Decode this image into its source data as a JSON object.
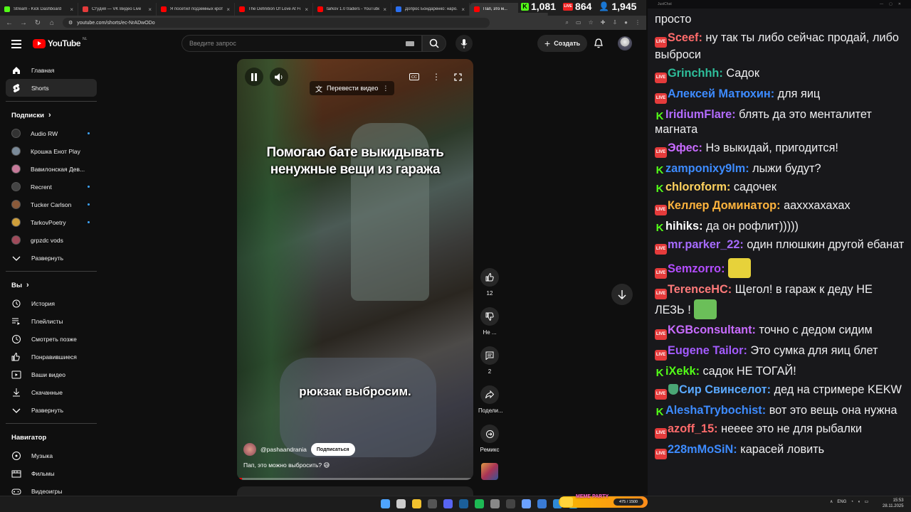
{
  "browser": {
    "tabs": [
      {
        "title": "Stream - Kick Dashboard",
        "color": "#53fc18"
      },
      {
        "title": "Студия — VK Видео Live",
        "color": "#e53b3b"
      },
      {
        "title": "Я посетил подземных крот...",
        "color": "#ff0000"
      },
      {
        "title": "The Definition Of Love At Fi...",
        "color": "#ff0000"
      },
      {
        "title": "tarkov 1.0 traders - YouTube",
        "color": "#ff0000"
      },
      {
        "title": "Допрос Бондаренко: наро...",
        "color": "#2a6ff0"
      },
      {
        "title": "Пап, это м...",
        "color": "#ff0000"
      }
    ],
    "url": "youtube.com/shorts/ec-NrADwODo"
  },
  "counters": {
    "kick": "1,081",
    "live": "864",
    "viewers": "1,945"
  },
  "youtube": {
    "logo": "YouTube",
    "region": "NL",
    "search_placeholder": "Введите запрос",
    "create_label": "Создать"
  },
  "sidebar": {
    "main": [
      {
        "label": "Главная",
        "icon": "home-icon"
      },
      {
        "label": "Shorts",
        "icon": "shorts-icon"
      }
    ],
    "subs_heading": "Подписки",
    "subscriptions": [
      {
        "label": "Audio RW",
        "dot": true,
        "color": "#333333"
      },
      {
        "label": "Крошка Енот Play",
        "dot": false,
        "color": "#7a8a99"
      },
      {
        "label": "Вавилонская Дев...",
        "dot": false,
        "color": "#c77a9a"
      },
      {
        "label": "Recrent",
        "dot": true,
        "color": "#444444"
      },
      {
        "label": "Tucker Carlson",
        "dot": true,
        "color": "#8a5a3a"
      },
      {
        "label": "TarkovPoetry",
        "dot": true,
        "color": "#cf9f3a"
      },
      {
        "label": "grpzdc vods",
        "dot": false,
        "color": "#a04a5a"
      },
      {
        "label": "Развернуть",
        "dot": false,
        "color": ""
      }
    ],
    "you_heading": "Вы",
    "you": [
      {
        "label": "История",
        "icon": "history-icon"
      },
      {
        "label": "Плейлисты",
        "icon": "playlists-icon"
      },
      {
        "label": "Смотреть позже",
        "icon": "watch-later-icon"
      },
      {
        "label": "Понравившиеся",
        "icon": "liked-icon"
      },
      {
        "label": "Ваши видео",
        "icon": "your-videos-icon"
      },
      {
        "label": "Скачанные",
        "icon": "downloads-icon"
      },
      {
        "label": "Развернуть",
        "icon": "chevron-down-icon"
      }
    ],
    "nav_heading": "Навигатор",
    "navigator": [
      {
        "label": "Музыка",
        "icon": "music-icon"
      },
      {
        "label": "Фильмы",
        "icon": "movies-icon"
      },
      {
        "label": "Видеоигры",
        "icon": "gaming-icon"
      }
    ]
  },
  "short": {
    "translate_label": "Перевести видео",
    "overlay_text": "Помогаю бате выкидывать ненужные вещи из гаража",
    "subtitle_text": "рюкзак выбросим.",
    "channel": "@pashaandrania",
    "subscribe_label": "Подписаться",
    "caption": "Пап, это можно выбросить? 😅",
    "progress": 0.02,
    "likes": "12",
    "dislike_label": "Не ...",
    "comments": "2",
    "share_label": "Подели...",
    "remix_label": "Ремикс"
  },
  "chat": {
    "app": "JustChat",
    "messages": [
      {
        "platform": "",
        "user": "",
        "color": "",
        "text": "просто"
      },
      {
        "platform": "live",
        "user": "Sceef",
        "color": "#ff6b6b",
        "text": "ну так ты либо сейчас продай, либо выброси"
      },
      {
        "platform": "live",
        "user": "Grinchhh",
        "color": "#2ebd9a",
        "text": "Садок"
      },
      {
        "platform": "live",
        "user": "Алексей Матюхин",
        "color": "#3d8bff",
        "text": "для яиц"
      },
      {
        "platform": "kick",
        "user": "IridiumFlare",
        "color": "#b36bff",
        "text": "блять да это менталитет магната"
      },
      {
        "platform": "live",
        "user": "Эфес",
        "color": "#c86bff",
        "text": "Нэ выкидай, пригодится!"
      },
      {
        "platform": "kick",
        "user": "zamponixy9lm",
        "color": "#3d8bff",
        "text": "лыжи будут?"
      },
      {
        "platform": "kick",
        "user": "chloroform",
        "color": "#ffd25e",
        "text": "садочек"
      },
      {
        "platform": "live",
        "user": "Келлер Доминатор",
        "color": "#ffb43d",
        "text": "аахххахахах"
      },
      {
        "platform": "kick",
        "user": "hihiks",
        "color": "#ffffff",
        "text": "да он рофлит)))))"
      },
      {
        "platform": "live",
        "user": "mr.parker_22",
        "color": "#a66bff",
        "text": "один плюшкин другой ебанат"
      },
      {
        "platform": "live",
        "user": "Semzorro",
        "color": "#b34dff",
        "text": "",
        "emote": "#e7d23a"
      },
      {
        "platform": "live",
        "user": "TerenceHC",
        "color": "#ff7a7a",
        "text": "Щегол! в гараж к деду НЕ ЛЕЗЬ !",
        "emote": "#6bbf59"
      },
      {
        "platform": "live",
        "user": "KGBconsultant",
        "color": "#c86bff",
        "text": "точно с дедом сидим"
      },
      {
        "platform": "live",
        "user": "Eugene Tailor",
        "color": "#a35bff",
        "text": "Это сумка для яиц блет"
      },
      {
        "platform": "kick",
        "user": "iXekk",
        "color": "#53fc18",
        "text": "садок НЕ ТОГАЙ!"
      },
      {
        "platform": "live",
        "user": "Сир Свинселот",
        "color": "#5aa9ff",
        "text": "дед на стримере KEKW",
        "shield": true
      },
      {
        "platform": "kick",
        "user": "AleshaTrybochist",
        "color": "#3d8bff",
        "text": "вот это вещь она нужна"
      },
      {
        "platform": "live",
        "user": "azoff_15",
        "color": "#ff6b6b",
        "text": "нееее это не для рыбалки"
      },
      {
        "platform": "live",
        "user": "228mMoSiN",
        "color": "#3d8bff",
        "text": "карасей ловить"
      }
    ]
  },
  "taskbar": {
    "meme_label": "MEME PARTY",
    "meme_count": "475 / 1500",
    "lang": "ENG",
    "time": "15:53",
    "date": "28.11.2025"
  }
}
